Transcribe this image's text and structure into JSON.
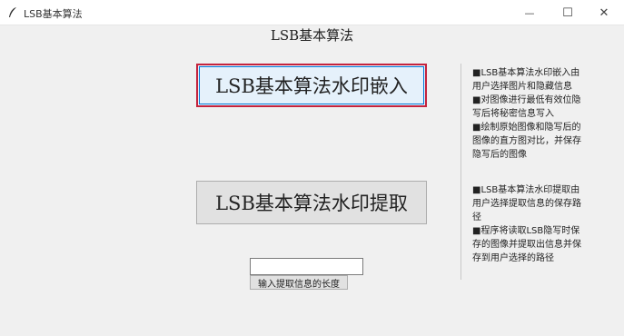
{
  "window": {
    "title": "LSB基本算法",
    "minimize": "—",
    "maximize": "☐",
    "close": "✕"
  },
  "main": {
    "heading": "LSB基本算法",
    "embed_button": "LSB基本算法水印嵌入",
    "extract_button": "LSB基本算法水印提取",
    "length_input_value": "",
    "length_button": "输入提取信息的长度"
  },
  "sidebar": {
    "embed_desc": "■LSB基本算法水印嵌入由\n用户选择图片和隐藏信息\n■对图像进行最低有效位隐\n写后将秘密信息写入\n■绘制原始图像和隐写后的\n图像的直方图对比，并保存\n隐写后的图像",
    "extract_desc": "■LSB基本算法水印提取由\n用户选择提取信息的保存路\n径\n■程序将读取LSB隐写时保\n存的图像并提取出信息并保\n存到用户选择的路径"
  },
  "icons": {
    "app": "feather-icon"
  },
  "colors": {
    "embed_button_bg": "#e5f1fb",
    "embed_button_border": "#c4233d"
  }
}
